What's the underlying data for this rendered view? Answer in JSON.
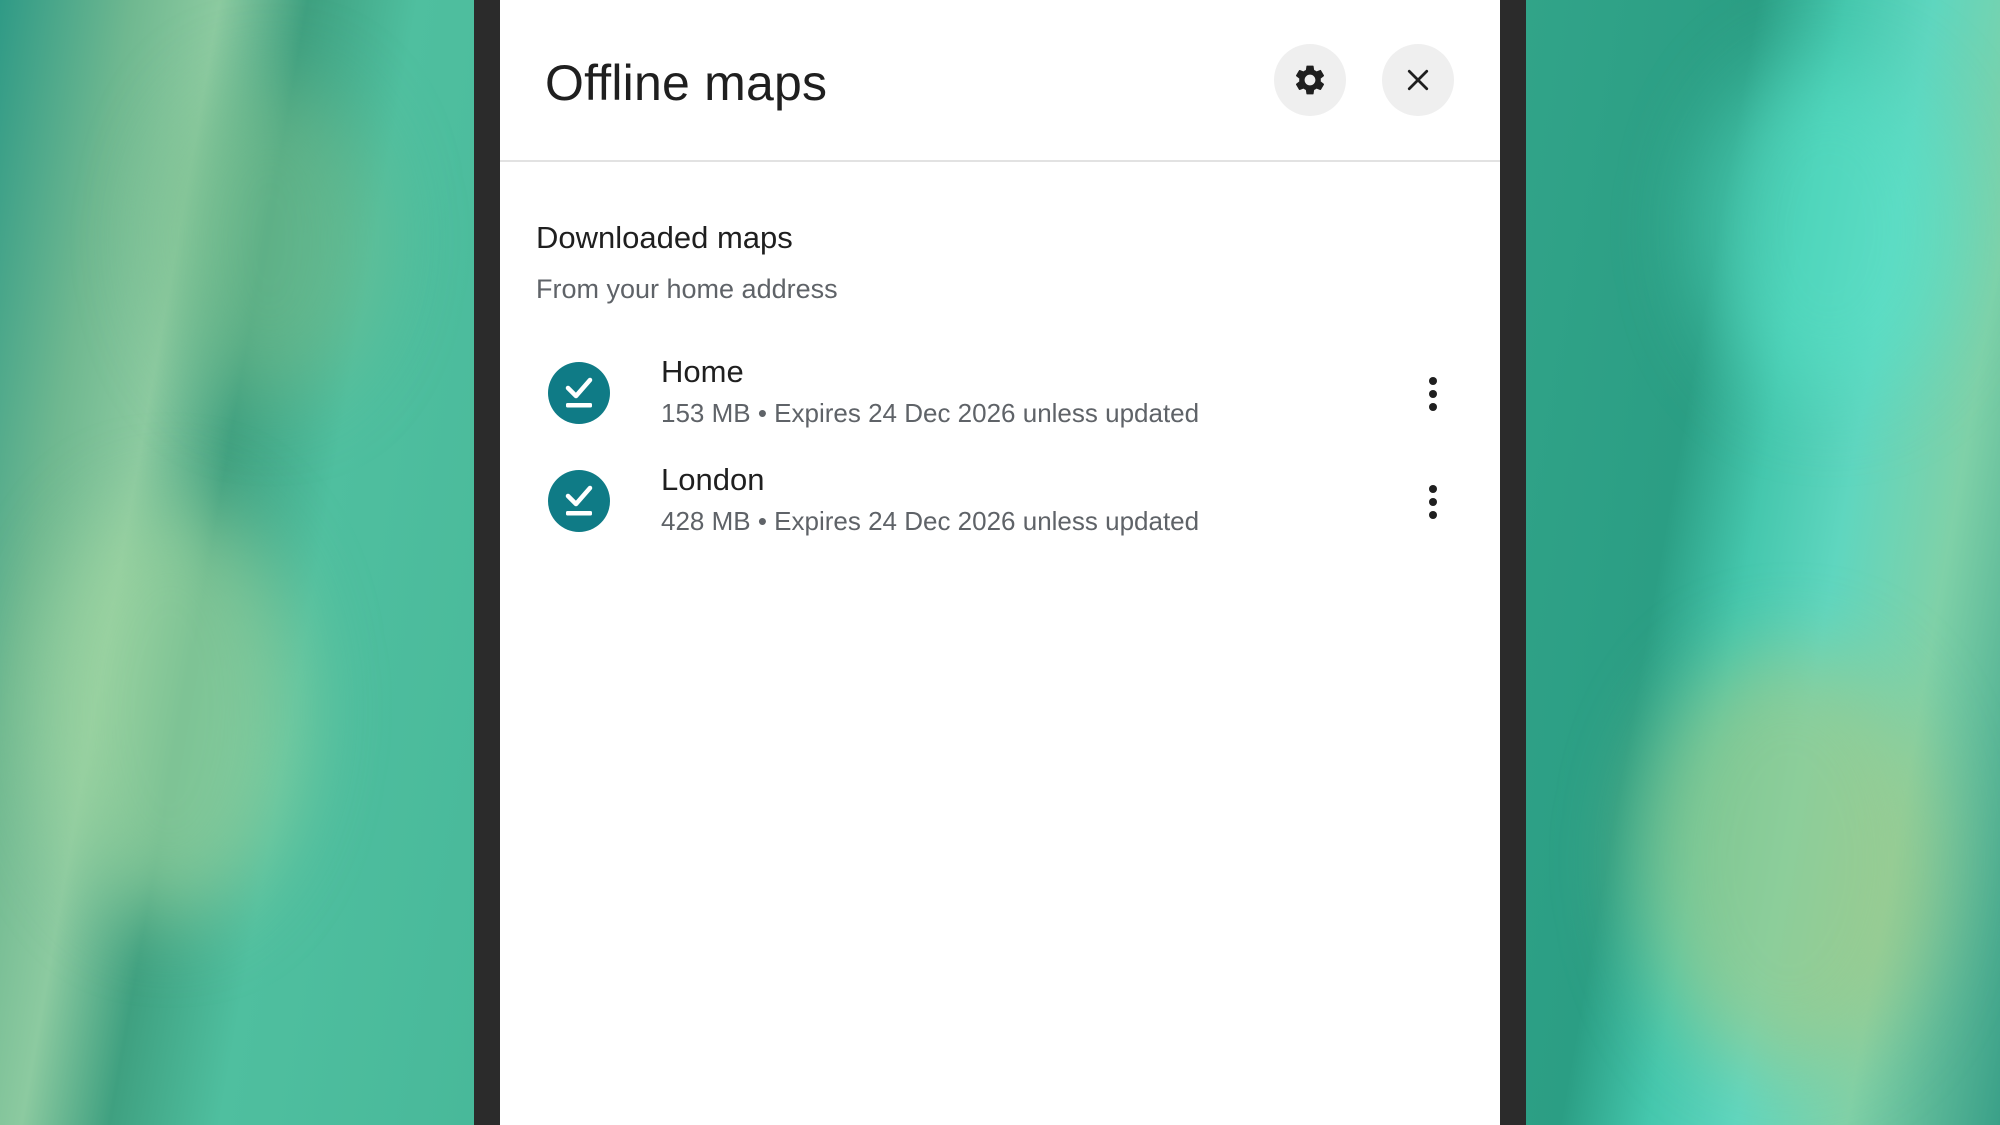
{
  "header": {
    "title": "Offline maps",
    "settings_icon": "gear-icon",
    "close_icon": "close-icon"
  },
  "section": {
    "title": "Downloaded maps",
    "subtitle": "From your home address"
  },
  "maps": [
    {
      "name": "Home",
      "meta": "153 MB • Expires 24 Dec 2026 unless updated",
      "icon": "download-done-icon"
    },
    {
      "name": "London",
      "meta": "428 MB • Expires 24 Dec 2026 unless updated",
      "icon": "download-done-icon"
    }
  ],
  "colors": {
    "accent": "#0f7b86",
    "panel": "#ffffff",
    "bezel": "#2b2b2b",
    "text_primary": "#1f1f1f",
    "text_secondary": "#5f6368"
  }
}
